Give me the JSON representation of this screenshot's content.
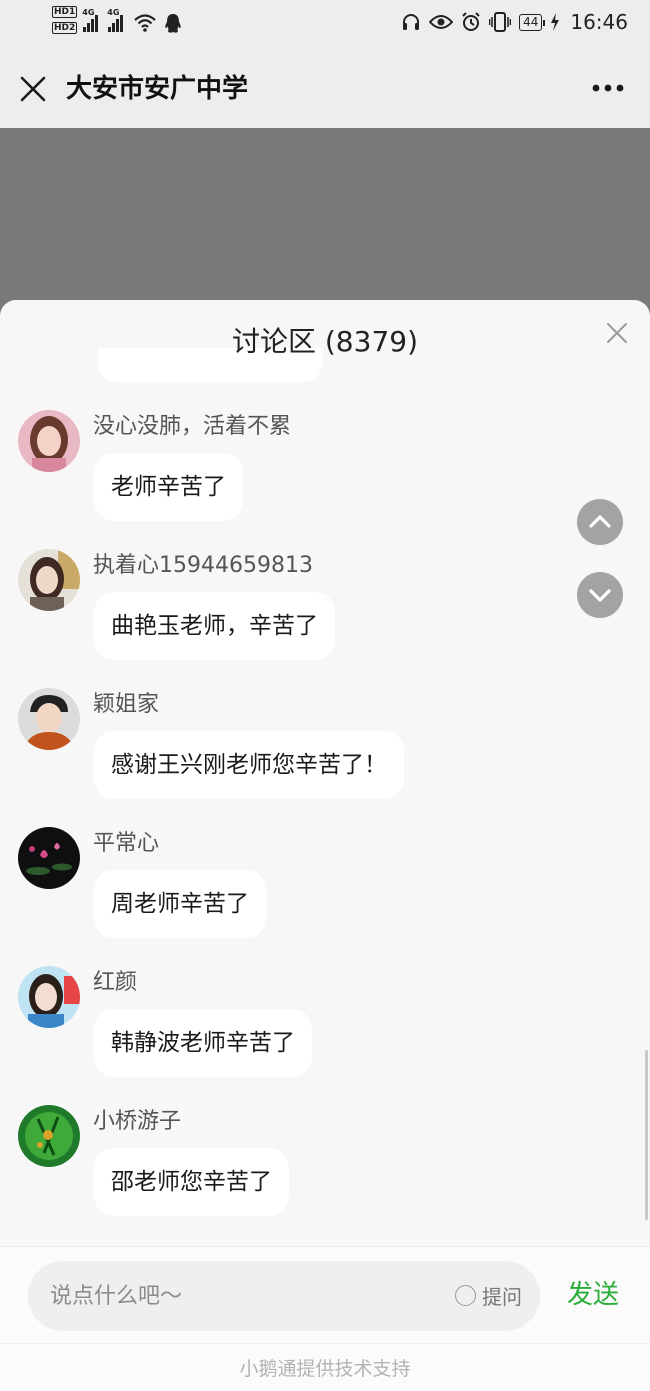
{
  "status_bar": {
    "hd1": "HD1",
    "hd2": "HD2",
    "net1": "4G",
    "net2": "4G",
    "battery": "44",
    "time": "16:46"
  },
  "nav": {
    "title": "大安市安广中学",
    "close_icon": "close-icon",
    "more_icon": "more-icon"
  },
  "discussion": {
    "title": "讨论区 (8379)",
    "messages": [
      {
        "user": "没心没肺，活着不累",
        "text": "老师辛苦了",
        "avatar": "avatar-girl-pink"
      },
      {
        "user": "执着心15944659813",
        "text": "曲艳玉老师，辛苦了",
        "avatar": "avatar-girl-window"
      },
      {
        "user": "颖姐家",
        "text": "感谢王兴刚老师您辛苦了！",
        "avatar": "avatar-boy"
      },
      {
        "user": "平常心",
        "text": "周老师辛苦了",
        "avatar": "avatar-lotus"
      },
      {
        "user": "红颜",
        "text": "韩静波老师辛苦了",
        "avatar": "avatar-girl-sky"
      },
      {
        "user": "小桥游子",
        "text": "邵老师您辛苦了",
        "avatar": "avatar-green-plant"
      }
    ]
  },
  "input": {
    "placeholder": "说点什么吧～",
    "ask_label": "提问",
    "send_label": "发送"
  },
  "footer": "小鹅通提供技术支持",
  "colors": {
    "send": "#2bad38",
    "backdrop": "#7a7a7a",
    "scroll_button": "#a3a3a3"
  }
}
